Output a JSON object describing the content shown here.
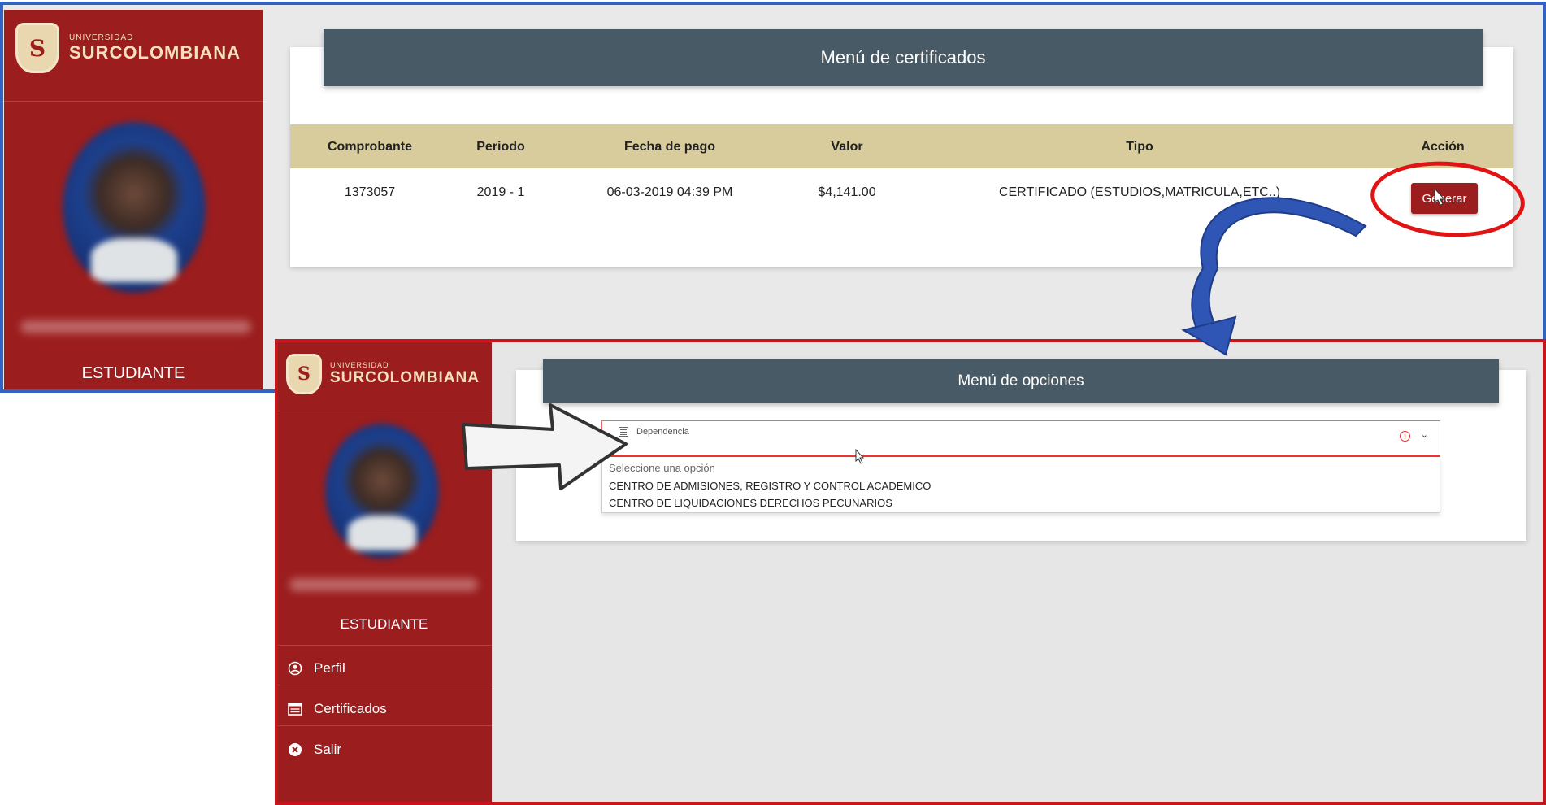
{
  "brand": {
    "university_prefix": "UNIVERSIDAD",
    "university_name": "SURCOLOMBIANA"
  },
  "top_panel": {
    "role": "ESTUDIANTE",
    "card_title": "Menú de certificados",
    "table": {
      "headers": [
        "Comprobante",
        "Periodo",
        "Fecha de pago",
        "Valor",
        "Tipo",
        "Acción"
      ],
      "rows": [
        {
          "comprobante": "1373057",
          "periodo": "2019 - 1",
          "fecha_pago": "06-03-2019 04:39 PM",
          "valor": "$4,141.00",
          "tipo": "CERTIFICADO (ESTUDIOS,MATRICULA,ETC..)",
          "accion": "Generar"
        }
      ]
    }
  },
  "bottom_panel": {
    "role": "ESTUDIANTE",
    "nav": [
      {
        "label": "Perfil",
        "icon": "user-circle-icon"
      },
      {
        "label": "Certificados",
        "icon": "certificate-icon"
      },
      {
        "label": "Salir",
        "icon": "close-circle-icon"
      }
    ],
    "card_title": "Menú de opciones",
    "select": {
      "label": "Dependencia",
      "placeholder": "Seleccione una opción",
      "options": [
        "CENTRO DE ADMISIONES, REGISTRO Y CONTROL ACADEMICO",
        "CENTRO DE LIQUIDACIONES DERECHOS PECUNARIOS"
      ]
    }
  },
  "colors": {
    "sidebar": "#9b1d1d",
    "header": "#485a65",
    "table_header": "#d8cb9c",
    "highlight": "#e01414",
    "panel1_border": "#3361c4",
    "panel2_border": "#c8141c"
  }
}
